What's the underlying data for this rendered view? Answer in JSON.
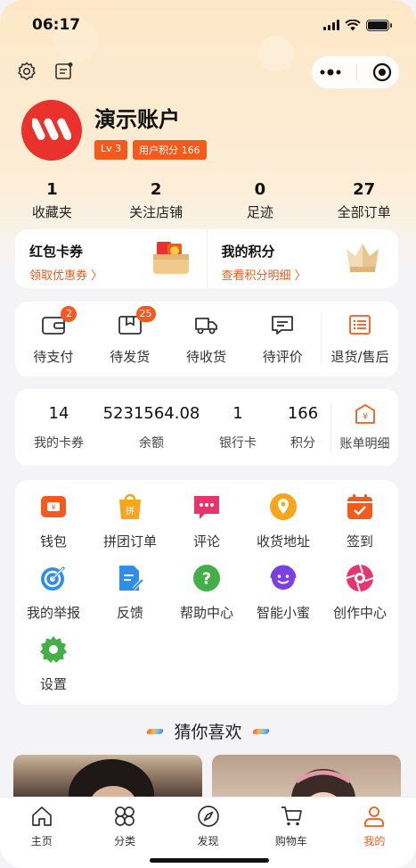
{
  "status": {
    "time": "06:17"
  },
  "profile": {
    "name": "演示账户",
    "level": "Lv 3",
    "points_tag": "用户积分 166"
  },
  "stats": [
    {
      "value": "1",
      "label": "收藏夹"
    },
    {
      "value": "2",
      "label": "关注店铺"
    },
    {
      "value": "0",
      "label": "足迹"
    },
    {
      "value": "27",
      "label": "全部订单"
    }
  ],
  "promo": {
    "left": {
      "title": "红包卡券",
      "link": "领取优惠券 〉"
    },
    "right": {
      "title": "我的积分",
      "link": "查看积分明细 〉"
    }
  },
  "orders": [
    {
      "label": "待支付",
      "badge": "2",
      "icon": "wallet-icon"
    },
    {
      "label": "待发货",
      "badge": "25",
      "icon": "package-icon"
    },
    {
      "label": "待收货",
      "badge": "",
      "icon": "truck-icon"
    },
    {
      "label": "待评价",
      "badge": "",
      "icon": "comment-icon"
    },
    {
      "label": "退货/售后",
      "badge": "",
      "icon": "return-icon"
    }
  ],
  "wallet": [
    {
      "value": "14",
      "label": "我的卡券"
    },
    {
      "value": "5231564.08",
      "label": "余额"
    },
    {
      "value": "1",
      "label": "银行卡"
    },
    {
      "value": "166",
      "label": "积分"
    }
  ],
  "wallet_bill": {
    "label": "账单明细",
    "icon": "bill-icon"
  },
  "tools": [
    {
      "label": "钱包",
      "icon": "wallet-icon",
      "color": "#f35a1c"
    },
    {
      "label": "拼团订单",
      "icon": "group-order-icon",
      "color": "#f5a623"
    },
    {
      "label": "评论",
      "icon": "comment-icon",
      "color": "#e8336e"
    },
    {
      "label": "收货地址",
      "icon": "location-icon",
      "color": "#f7a51c"
    },
    {
      "label": "签到",
      "icon": "calendar-check-icon",
      "color": "#f35a1c"
    },
    {
      "label": "我的举报",
      "icon": "target-icon",
      "color": "#2f8fe8"
    },
    {
      "label": "反馈",
      "icon": "document-edit-icon",
      "color": "#2f8fe8"
    },
    {
      "label": "帮助中心",
      "icon": "help-icon",
      "color": "#43b047"
    },
    {
      "label": "智能小蜜",
      "icon": "smile-assistant-icon",
      "color": "#7b3fe4"
    },
    {
      "label": "创作中心",
      "icon": "camera-aperture-icon",
      "color": "#e8336e"
    },
    {
      "label": "设置",
      "icon": "gear-icon",
      "color": "#43b047"
    }
  ],
  "guess": {
    "title": "猜你喜欢"
  },
  "tabbar": [
    {
      "label": "主页",
      "icon": "home-icon",
      "active": false
    },
    {
      "label": "分类",
      "icon": "category-icon",
      "active": false
    },
    {
      "label": "发现",
      "icon": "compass-icon",
      "active": false
    },
    {
      "label": "购物车",
      "icon": "cart-icon",
      "active": false
    },
    {
      "label": "我的",
      "icon": "user-icon",
      "active": true
    }
  ],
  "colors": {
    "accent": "#f35a1c",
    "header_bg": "#fde7c6",
    "brand_red": "#e8322b"
  }
}
